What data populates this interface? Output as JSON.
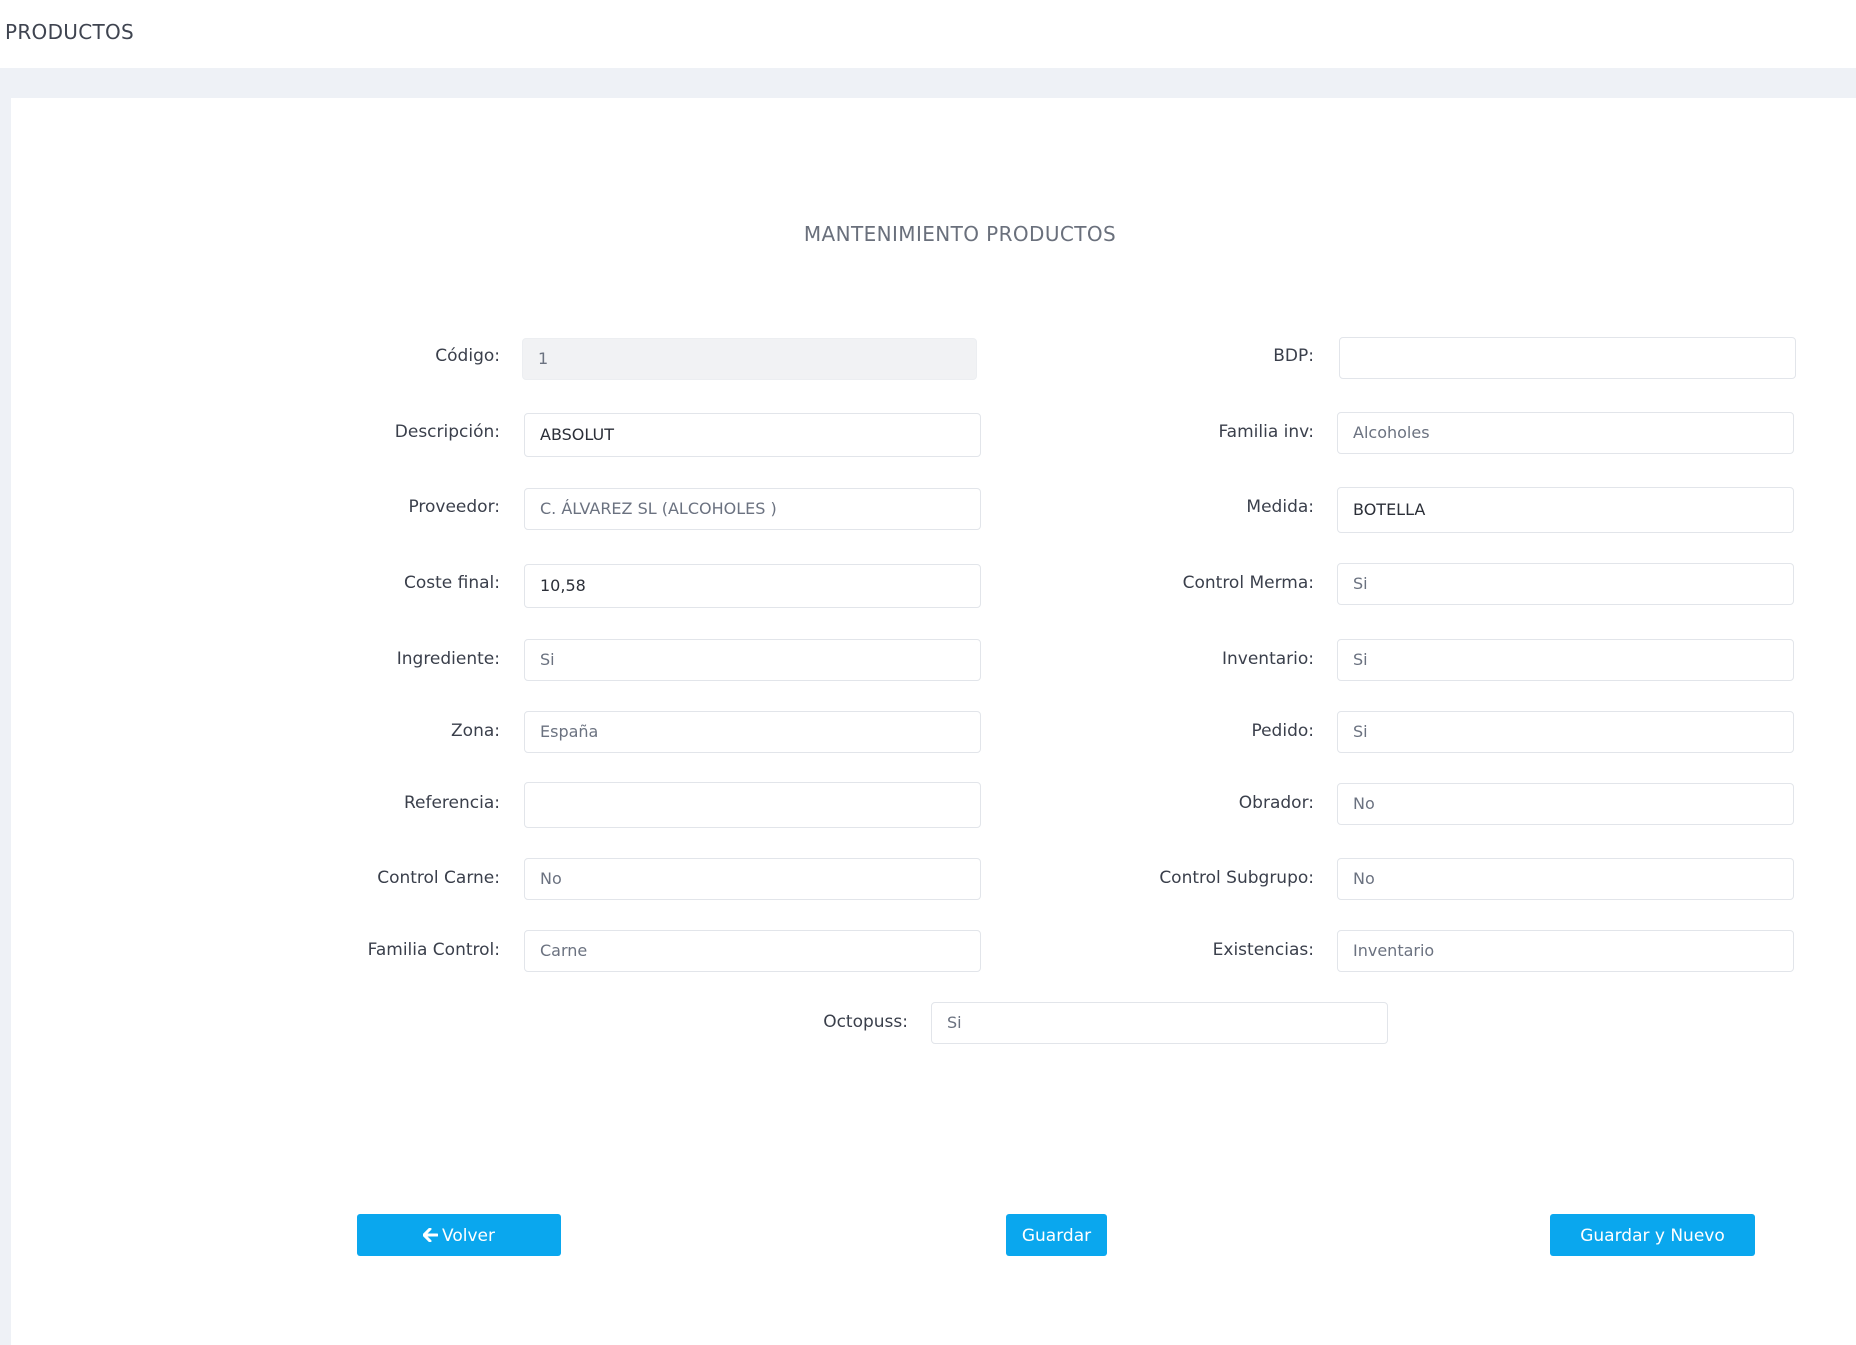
{
  "header": {
    "title": "PRODUCTOS"
  },
  "form": {
    "title": "MANTENIMIENTO PRODUCTOS",
    "left": [
      {
        "label": "Código:",
        "value": "1"
      },
      {
        "label": "Descripción:",
        "value": "ABSOLUT"
      },
      {
        "label": "Proveedor:",
        "value": "C. ÁLVAREZ SL (ALCOHOLES )"
      },
      {
        "label": "Coste final:",
        "value": "10,58"
      },
      {
        "label": "Ingrediente:",
        "value": "Si"
      },
      {
        "label": "Zona:",
        "value": "España"
      },
      {
        "label": "Referencia:",
        "value": ""
      },
      {
        "label": "Control Carne:",
        "value": "No"
      },
      {
        "label": "Familia Control:",
        "value": "Carne"
      }
    ],
    "right": [
      {
        "label": "BDP:",
        "value": ""
      },
      {
        "label": "Familia inv:",
        "value": "Alcoholes"
      },
      {
        "label": "Medida:",
        "value": "BOTELLA"
      },
      {
        "label": "Control Merma:",
        "value": "Si"
      },
      {
        "label": "Inventario:",
        "value": "Si"
      },
      {
        "label": "Pedido:",
        "value": "Si"
      },
      {
        "label": "Obrador:",
        "value": "No"
      },
      {
        "label": "Control Subgrupo:",
        "value": "No"
      },
      {
        "label": "Existencias:",
        "value": "Inventario"
      }
    ],
    "center": {
      "label": "Octopuss:",
      "value": "Si"
    }
  },
  "buttons": {
    "back_label": "Volver",
    "back_icon": "arrow-left-icon",
    "save_label": "Guardar",
    "save_new_label": "Guardar y Nuevo"
  },
  "colors": {
    "accent": "#0aa7ee",
    "background": "#eef1f6"
  }
}
